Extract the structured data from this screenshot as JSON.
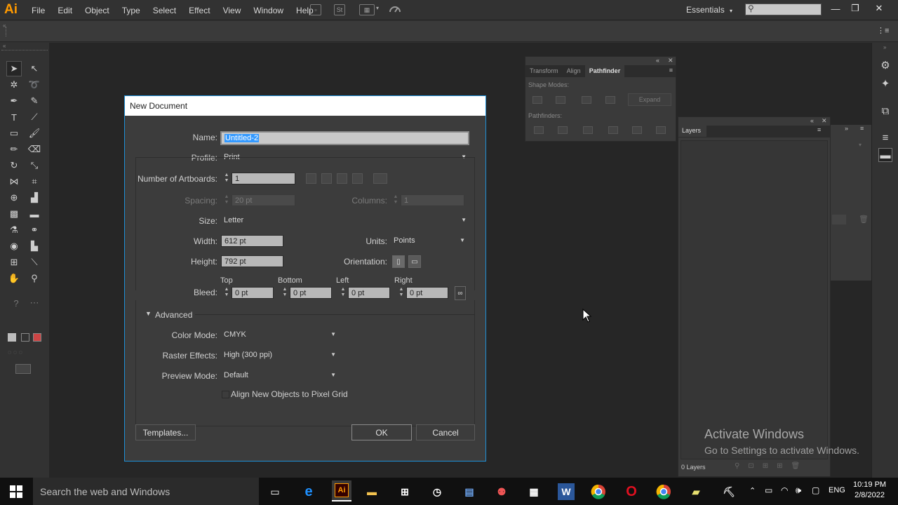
{
  "app": {
    "logo": "Ai"
  },
  "menu": [
    "File",
    "Edit",
    "Object",
    "Type",
    "Select",
    "Effect",
    "View",
    "Window",
    "Help"
  ],
  "toolbar": {
    "st_label": "St",
    "workspace": "Essentials",
    "workspace_arrow": "▾"
  },
  "window_buttons": {
    "minimize": "—",
    "restore": "❐",
    "close": "✕"
  },
  "pathfinder_panel": {
    "tabs": [
      "Transform",
      "Align",
      "Pathfinder"
    ],
    "active_tab": "Pathfinder",
    "shape_modes_label": "Shape Modes:",
    "pathfinders_label": "Pathfinders:",
    "expand_label": "Expand"
  },
  "layers_panel": {
    "tab": "Layers",
    "count": "0 Layers"
  },
  "dialog": {
    "title": "New Document",
    "name_label": "Name:",
    "name_value": "Untitled-2",
    "profile_label": "Profile:",
    "profile_value": "Print",
    "artboards_label": "Number of Artboards:",
    "artboards_value": "1",
    "spacing_label": "Spacing:",
    "spacing_value": "20 pt",
    "columns_label": "Columns:",
    "columns_value": "1",
    "size_label": "Size:",
    "size_value": "Letter",
    "width_label": "Width:",
    "width_value": "612 pt",
    "units_label": "Units:",
    "units_value": "Points",
    "height_label": "Height:",
    "height_value": "792 pt",
    "orientation_label": "Orientation:",
    "bleed_label": "Bleed:",
    "bleed_top_label": "Top",
    "bleed_bottom_label": "Bottom",
    "bleed_left_label": "Left",
    "bleed_right_label": "Right",
    "bleed_top": "0 pt",
    "bleed_bottom": "0 pt",
    "bleed_left": "0 pt",
    "bleed_right": "0 pt",
    "advanced_label": "Advanced",
    "color_mode_label": "Color Mode:",
    "color_mode_value": "CMYK",
    "raster_label": "Raster Effects:",
    "raster_value": "High (300 ppi)",
    "preview_label": "Preview Mode:",
    "preview_value": "Default",
    "align_grid_label": "Align New Objects to Pixel Grid",
    "templates_button": "Templates...",
    "ok_button": "OK",
    "cancel_button": "Cancel"
  },
  "watermark": {
    "line1": "Activate Windows",
    "line2": "Go to Settings to activate Windows."
  },
  "taskbar": {
    "search_placeholder": "Search the web and Windows",
    "ai_label": "Ai",
    "word_label": "W",
    "language": "ENG",
    "time": "10:19 PM",
    "date": "2/8/2022"
  },
  "colors": {
    "accent": "#1e8fd6",
    "ai_orange": "#ff9a00",
    "selection": "#3399ff"
  }
}
